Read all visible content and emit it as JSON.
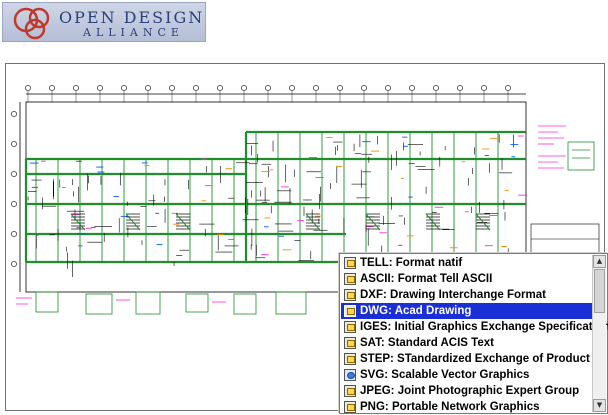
{
  "brand": {
    "line1": "OPEN DESIGN",
    "line2": "ALLIANCE",
    "colors": {
      "banner": "#c4cce0",
      "text": "#2b3f7a",
      "rings": "#c0392b"
    }
  },
  "drawing": {
    "description_icon": "cad-floor-plan",
    "line_colors": [
      "#1f8f2e",
      "#000000",
      "#ff2bd8",
      "#ff8a00",
      "#0057ff"
    ]
  },
  "format_list": {
    "selected_index": 3,
    "selection_color": "#1b2fd6",
    "items": [
      {
        "label": "TELL: Format natif",
        "icon": "document-icon"
      },
      {
        "label": "ASCII: Format Tell ASCII",
        "icon": "document-icon"
      },
      {
        "label": "DXF: Drawing Interchange Format",
        "icon": "document-icon"
      },
      {
        "label": "DWG: Acad Drawing",
        "icon": "document-icon"
      },
      {
        "label": "IGES: Initial Graphics Exchange Specification",
        "icon": "document-icon"
      },
      {
        "label": "SAT: Standard ACIS Text",
        "icon": "document-icon"
      },
      {
        "label": "STEP: STandardized Exchange of Product",
        "icon": "document-icon"
      },
      {
        "label": "SVG: Scalable Vector Graphics",
        "icon": "svg-icon"
      },
      {
        "label": "JPEG: Joint Photographic Expert Group",
        "icon": "document-icon"
      },
      {
        "label": "PNG: Portable Network Graphics",
        "icon": "document-icon"
      }
    ]
  }
}
